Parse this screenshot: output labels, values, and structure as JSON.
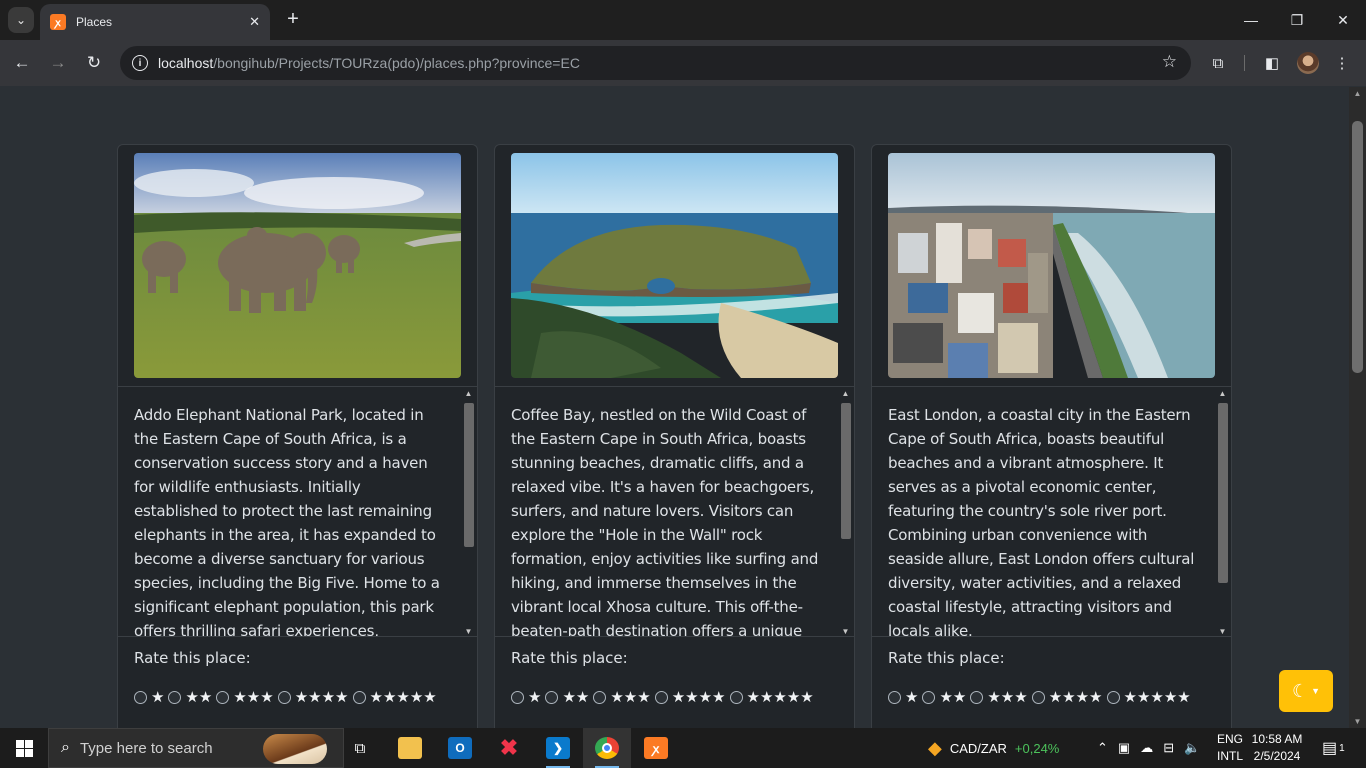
{
  "browser": {
    "tab_title": "Places",
    "url_host": "localhost",
    "url_path": "/bongihub/Projects/TOURza(pdo)/places.php?province=EC"
  },
  "places": [
    {
      "image": "elephants-grassland",
      "description": "Addo Elephant National Park, located in the Eastern Cape of South Africa, is a conservation success story and a haven for wildlife enthusiasts. Initially established to protect the last remaining elephants in the area, it has expanded to become a diverse sanctuary for various species, including the Big Five. Home to a significant elephant population, this park offers thrilling safari experiences, stunning landscapes, and the",
      "rate_label": "Rate this place:"
    },
    {
      "image": "hole-in-the-wall-coast",
      "description": "Coffee Bay, nestled on the Wild Coast of the Eastern Cape in South Africa, boasts stunning beaches, dramatic cliffs, and a relaxed vibe. It's a haven for beachgoers, surfers, and nature lovers. Visitors can explore the \"Hole in the Wall\" rock formation, enjoy activities like surfing and hiking, and immerse themselves in the vibrant local Xhosa culture. This off-the-beaten-path destination offers a unique",
      "rate_label": "Rate this place:"
    },
    {
      "image": "coastal-city-aerial",
      "description": "East London, a coastal city in the Eastern Cape of South Africa, boasts beautiful beaches and a vibrant atmosphere. It serves as a pivotal economic center, featuring the country's sole river port. Combining urban convenience with seaside allure, East London offers cultural diversity, water activities, and a relaxed coastal lifestyle, attracting visitors and locals alike.",
      "rate_label": "Rate this place:"
    }
  ],
  "rating_options": [
    "★",
    "★★",
    "★★★",
    "★★★★",
    "★★★★★"
  ],
  "theme_toggle_icon": "moon-icon",
  "colors": {
    "accent": "#ffc107",
    "page_bg": "#2b3035",
    "card_bg": "#212529"
  },
  "taskbar": {
    "search_placeholder": "Type here to search",
    "ticker_label": "CAD/ZAR",
    "ticker_change": "+0,24%",
    "lang_top": "ENG",
    "lang_bottom": "INTL",
    "time": "10:58 AM",
    "date": "2/5/2024",
    "notification_count": "1"
  }
}
